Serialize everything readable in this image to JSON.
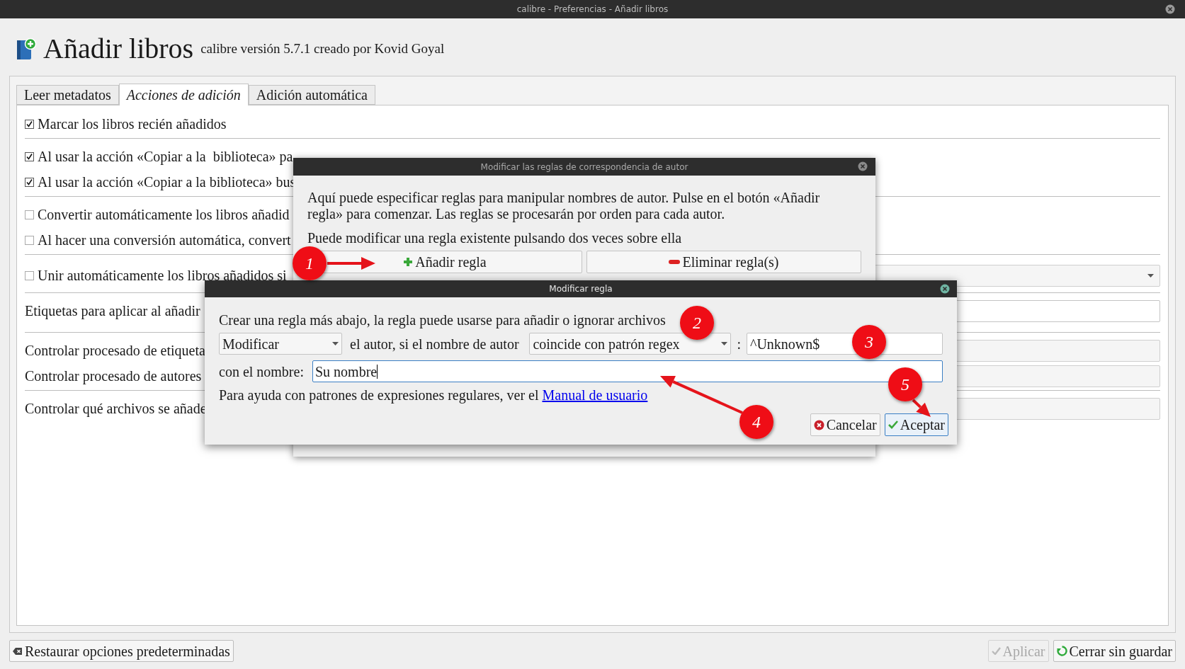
{
  "window": {
    "title": "calibre - Preferencias - Añadir libros"
  },
  "header": {
    "title": "Añadir libros",
    "subtitle": "calibre versión 5.7.1 creado por Kovid Goyal"
  },
  "tabs": [
    {
      "label": "Leer metadatos",
      "selected": false
    },
    {
      "label": "Acciones de adición",
      "selected": true
    },
    {
      "label": "Adición automática",
      "selected": false
    }
  ],
  "option_groups": [
    [
      {
        "kind": "checkbox",
        "label": "Marcar los libros recién añadidos",
        "checked": true
      }
    ],
    [
      {
        "kind": "checkbox",
        "label": "Al usar la acción «Copiar a la  biblioteca» pa",
        "checked": true
      },
      {
        "kind": "checkbox",
        "label": "Al usar la acción «Copiar a la biblioteca» bus",
        "checked": true
      }
    ],
    [
      {
        "kind": "checkbox",
        "label": "Convertir automáticamente los libros añadid",
        "checked": false
      },
      {
        "kind": "checkbox",
        "label": "Al hacer una conversión automática, convert",
        "checked": false
      }
    ],
    [
      {
        "kind": "checkbox_combo",
        "label": "Unir automáticamente los libros añadidos si",
        "checked": false
      }
    ],
    [
      {
        "kind": "field",
        "label": "Etiquetas para aplicar al añadir"
      }
    ],
    [
      {
        "kind": "button",
        "label": "Controlar procesado de etiqueta"
      },
      {
        "kind": "button",
        "label": "Controlar procesado de autores"
      }
    ],
    [
      {
        "kind": "button",
        "label": "Controlar qué archivos se añade"
      }
    ]
  ],
  "author_rules_dialog": {
    "title": "Modificar las reglas de correspondencia de autor",
    "intro": "Aquí puede especificar reglas para manipular nombres de autor. Pulse en el botón «Añadir regla» para comenzar. Las reglas se procesarán por orden para cada autor.",
    "hint": "Puede modificar una regla existente pulsando dos veces sobre ella",
    "buttons": [
      {
        "kind": "add",
        "label": "Añadir regla"
      },
      {
        "kind": "remove",
        "label": "Eliminar regla(s)"
      }
    ]
  },
  "rule_dialog": {
    "title": "Modificar regla",
    "intro": "Crear una regla más abajo, la regla puede usarse para añadir o ignorar archivos",
    "action": "Modificar",
    "condition_text": "el autor, si el nombre de autor",
    "match": "coincide con patrón regex",
    "colon": ":",
    "pattern": "^Unknown$",
    "replace_label": "con el nombre:",
    "replace_value": "Su nombre",
    "help": "Para ayuda con patrones de expresiones regulares, ver el",
    "help_link": "Manual de usuario",
    "buttons": [
      {
        "kind": "cancel",
        "label": "Cancelar",
        "default": false
      },
      {
        "kind": "ok",
        "label": "Aceptar",
        "default": true
      }
    ]
  },
  "annotations": [
    {
      "label": "1",
      "arrow": true
    },
    {
      "label": "2",
      "arrow": false
    },
    {
      "label": "3",
      "arrow": false
    },
    {
      "label": "4",
      "arrow": true
    },
    {
      "label": "5",
      "arrow": true
    }
  ],
  "footer": {
    "buttons": [
      {
        "kind": "restore",
        "label": "Restaurar opciones predeterminadas",
        "disabled": false
      },
      {
        "kind": "apply",
        "label": "Aplicar",
        "disabled": true
      },
      {
        "kind": "close",
        "label": "Cerrar sin guardar",
        "disabled": false
      }
    ]
  }
}
